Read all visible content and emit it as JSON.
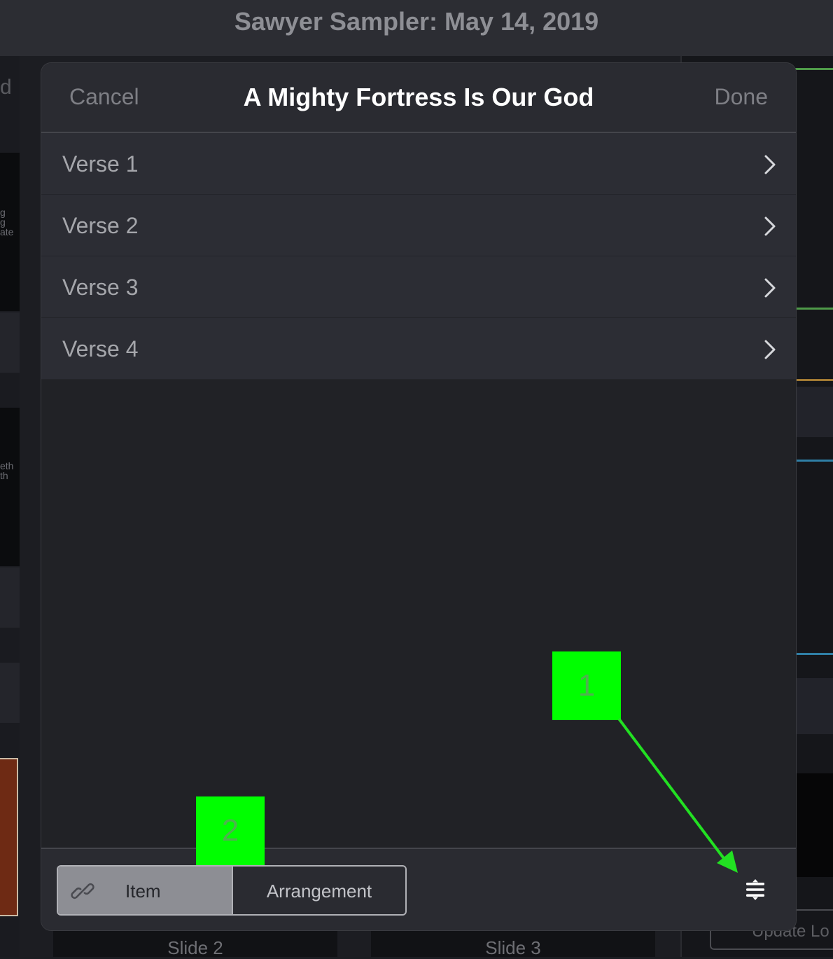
{
  "app": {
    "title": "Sawyer Sampler: May 14, 2019",
    "left_fragment": "d",
    "left_text_1": "g\ng\nate",
    "left_text_2": "eth\nth",
    "update_button": "Update Lo",
    "slides": [
      "Slide 2",
      "Slide 3"
    ]
  },
  "modal": {
    "title": "A Mighty Fortress Is Our God",
    "cancel_label": "Cancel",
    "done_label": "Done",
    "items": [
      {
        "label": "Verse 1"
      },
      {
        "label": "Verse 2"
      },
      {
        "label": "Verse 3"
      },
      {
        "label": "Verse 4"
      }
    ],
    "segment": {
      "item_label": "Item",
      "arrangement_label": "Arrangement",
      "selected": "Item"
    },
    "icons": {
      "segment_icon": "link-icon",
      "reorder_icon": "reorder-menu-icon",
      "row_icon": "chevron-right-icon"
    }
  },
  "annotations": [
    {
      "label": "1"
    },
    {
      "label": "2"
    }
  ],
  "colors": {
    "annotation": "#00ff00",
    "modal_background": "#212226",
    "row_background": "#2c2d34",
    "segment_selected": "#8d8e94"
  }
}
